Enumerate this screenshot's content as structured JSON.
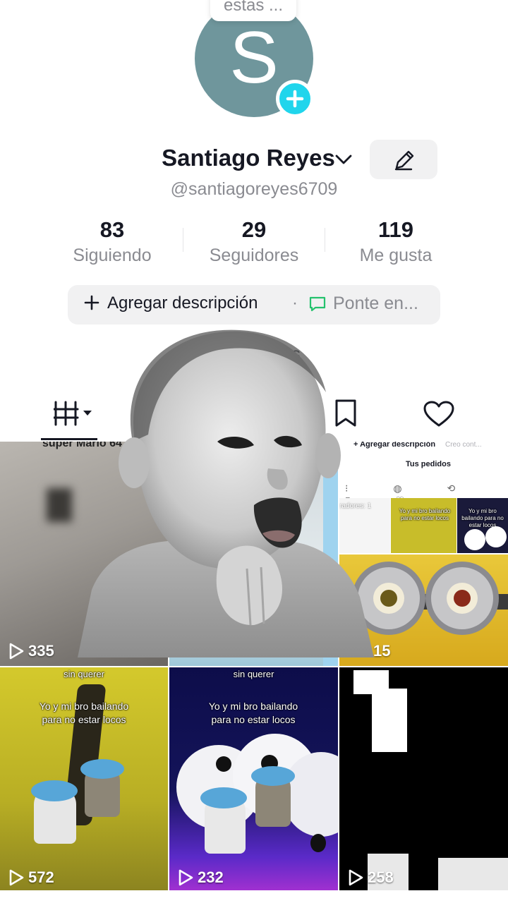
{
  "tooltip_bubble": "estas ...",
  "profile": {
    "avatar_letter": "S",
    "name": "Santiago Reyes",
    "handle": "@santiagoreyes6709"
  },
  "stats": [
    {
      "value": "83",
      "label": "Siguiendo"
    },
    {
      "value": "29",
      "label": "Seguidores"
    },
    {
      "value": "119",
      "label": "Me gusta"
    }
  ],
  "description": {
    "add_label": "Agregar descripción",
    "separator": "·",
    "status": "Ponte en..."
  },
  "orders_label_partial": "idos",
  "videos": [
    {
      "views": "335",
      "overlay_text": "super Mario 64"
    },
    {
      "views": "",
      "overlay_text": ""
    },
    {
      "views": "15",
      "overlay_text": ""
    },
    {
      "views": "572",
      "overlay_text": "sin querer",
      "caption": "Yo y mi bro bailando para no estar locos"
    },
    {
      "views": "232",
      "overlay_text": "sin querer",
      "caption": "Yo y mi bro bailando para no estar locos"
    },
    {
      "views": "258",
      "overlay_text": ""
    }
  ],
  "mini_screenshot": {
    "add_label": "+ Agregar descripción",
    "creo": "Creo cont...",
    "orders": "Tus pedidos",
    "followers": "radores: 1",
    "caption_small": "Yo y mi bro bailando para no estar locos",
    "sin_querer": "sin querer"
  },
  "colors": {
    "accent": "#20d5ec",
    "avatar_bg": "#6f969c",
    "orders_red": "#fe2c55",
    "status_green": "#25c26e"
  }
}
